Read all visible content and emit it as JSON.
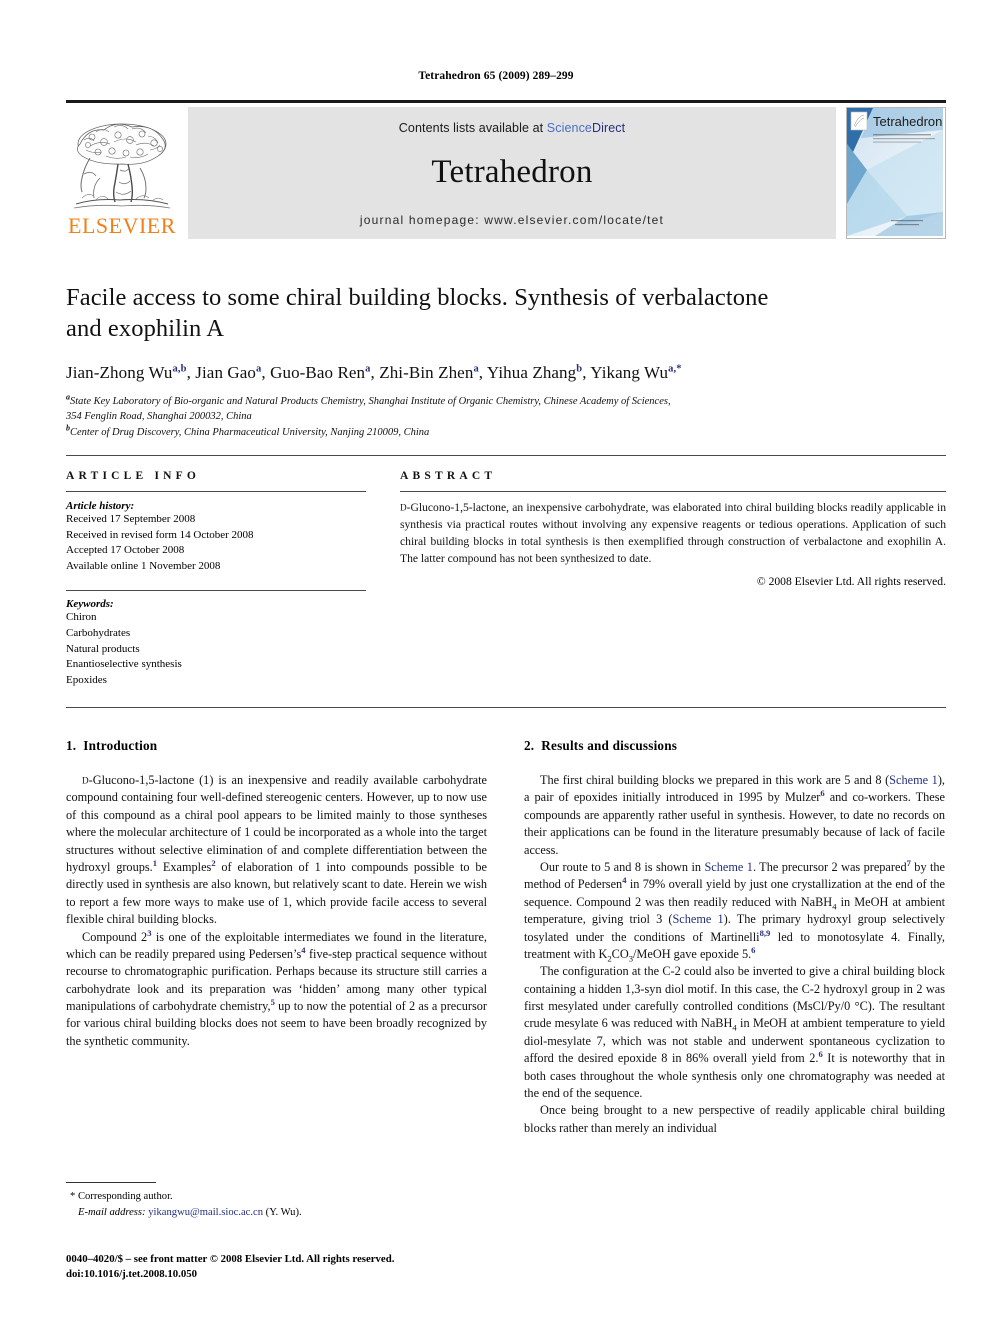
{
  "running_head": "Tetrahedron 65 (2009) 289–299",
  "masthead": {
    "contents_prefix": "Contents lists available at ",
    "sciencedirect_part1": "Science",
    "sciencedirect_part2": "Direct",
    "journal_name": "Tetrahedron",
    "homepage": "journal homepage: www.elsevier.com/locate/tet",
    "publisher_wordmark": "ELSEVIER",
    "publisher_logo_icon": "elsevier-tree-icon",
    "cover_title": "Tetrahedron",
    "cover_icon": "journal-cover-thumbnail",
    "accent_orange": "#f08019",
    "link_blue": "#24307e",
    "banner_gray": "#e3e3e3"
  },
  "article": {
    "title_line1": "Facile access to some chiral building blocks. Synthesis of verbalactone",
    "title_line2": "and exophilin A",
    "authors": [
      {
        "name": "Jian-Zhong Wu",
        "sup": "a,b",
        "sep": ", "
      },
      {
        "name": "Jian Gao",
        "sup": "a",
        "sep": ", "
      },
      {
        "name": "Guo-Bao Ren",
        "sup": "a",
        "sep": ", "
      },
      {
        "name": "Zhi-Bin Zhen",
        "sup": "a",
        "sep": ", "
      },
      {
        "name": "Yihua Zhang",
        "sup": "b",
        "sep": ", "
      },
      {
        "name": "Yikang Wu",
        "sup": "a,*",
        "sep": ""
      }
    ],
    "affiliations": [
      {
        "marker": "a",
        "text": "State Key Laboratory of Bio-organic and Natural Products Chemistry, Shanghai Institute of Organic Chemistry, Chinese Academy of Sciences,"
      },
      {
        "marker": "",
        "text": "354 Fenglin Road, Shanghai 200032, China"
      },
      {
        "marker": "b",
        "text": "Center of Drug Discovery, China Pharmaceutical University, Nanjing 210009, China"
      }
    ]
  },
  "article_info": {
    "heading": "ARTICLE INFO",
    "history_label": "Article history:",
    "history": [
      "Received 17 September 2008",
      "Received in revised form 14 October 2008",
      "Accepted 17 October 2008",
      "Available online 1 November 2008"
    ],
    "keywords_label": "Keywords:",
    "keywords": [
      "Chiron",
      "Carbohydrates",
      "Natural products",
      "Enantioselective synthesis",
      "Epoxides"
    ]
  },
  "abstract": {
    "heading": "ABSTRACT",
    "lead_smallcap": "D",
    "body": "-Glucono-1,5-lactone, an inexpensive carbohydrate, was elaborated into chiral building blocks readily applicable in synthesis via practical routes without involving any expensive reagents or tedious operations. Application of such chiral building blocks in total synthesis is then exemplified through construction of verbalactone and exophilin A. The latter compound has not been synthesized to date.",
    "copyright": "© 2008 Elsevier Ltd. All rights reserved."
  },
  "sections": {
    "intro": {
      "number": "1.",
      "title": "Introduction",
      "p1_lead_smallcap": "D",
      "p1_rest": "-Glucono-1,5-lactone (1) is an inexpensive and readily available carbohydrate compound containing four well-defined stereogenic centers. However, up to now use of this compound as a chiral pool appears to be limited mainly to those syntheses where the molecular architecture of 1 could be incorporated as a whole into the target structures without selective elimination of and complete differentiation between the hydroxyl groups.",
      "p1_ref1": "1",
      "p1_mid": " Examples",
      "p1_ref2": "2",
      "p1_tail": " of elaboration of 1 into compounds possible to be directly used in synthesis are also known, but relatively scant to date. Herein we wish to report a few more ways to make use of 1, which provide facile access to several flexible chiral building blocks.",
      "p2_a": "Compound 2",
      "p2_ref3": "3",
      "p2_b": " is one of the exploitable intermediates we found in the literature, which can be readily prepared using Pedersen’s",
      "p2_ref4": "4",
      "p2_c": " five-step practical sequence without recourse to chromatographic purification. Perhaps because its structure still carries a carbohydrate look and its preparation was ‘hidden’ among many other typical manipulations of carbohydrate chemistry,",
      "p2_ref5": "5",
      "p2_d": " up to now the potential of 2 as a precursor for various chiral building blocks does not seem to have been broadly recognized by the synthetic community."
    },
    "results": {
      "number": "2.",
      "title": "Results and discussions",
      "p1_a": "The first chiral building blocks we prepared in this work are 5 and 8 (",
      "p1_scheme": "Scheme 1",
      "p1_b": "), a pair of epoxides initially introduced in 1995 by Mulzer",
      "p1_ref6": "6",
      "p1_c": " and co-workers. These compounds are apparently rather useful in synthesis. However, to date no records on their applications can be found in the literature presumably because of lack of facile access.",
      "p2_a": "Our route to 5 and 8 is shown in ",
      "p2_scheme": "Scheme 1",
      "p2_b": ". The precursor 2 was prepared",
      "p2_ref7": "7",
      "p2_c": " by the method of Pedersen",
      "p2_ref4": "4",
      "p2_d": " in 79% overall yield by just one crystallization at the end of the sequence. Compound 2 was then readily reduced with NaBH",
      "p2_sub4": "4",
      "p2_e": " in MeOH at ambient temperature, giving triol 3 (",
      "p2_scheme2": "Scheme 1",
      "p2_f": "). The primary hydroxyl group selectively tosylated under the conditions of Martinelli",
      "p2_ref89": "8,9",
      "p2_g": " led to monotosylate 4. Finally, treatment with K",
      "p2_sub2": "2",
      "p2_h": "CO",
      "p2_sub3": "3",
      "p2_i": "/MeOH gave epoxide 5.",
      "p2_ref6b": "6",
      "p3_a": "The configuration at the C-2 could also be inverted to give a chiral building block containing a hidden 1,3-syn diol motif. In this case, the C-2 hydroxyl group in 2 was first mesylated under carefully controlled conditions (MsCl/Py/0 °C). The resultant crude mesylate 6 was reduced with NaBH",
      "p3_sub4": "4",
      "p3_b": " in MeOH at ambient temperature to yield diol-mesylate 7, which was not stable and underwent spontaneous cyclization to afford the desired epoxide 8 in 86% overall yield from 2.",
      "p3_ref6": "6",
      "p3_c": " It is noteworthy that in both cases throughout the whole synthesis only one chromatography was needed at the end of the sequence.",
      "p4": "Once being brought to a new perspective of readily applicable chiral building blocks rather than merely an individual"
    }
  },
  "footnote": {
    "corresponding": "* Corresponding author.",
    "email_label": "E-mail address:",
    "email": "yikangwu@mail.sioc.ac.cn",
    "email_suffix": " (Y. Wu)."
  },
  "imprint": {
    "line1": "0040–4020/$ – see front matter © 2008 Elsevier Ltd. All rights reserved.",
    "line2": "doi:10.1016/j.tet.2008.10.050"
  }
}
